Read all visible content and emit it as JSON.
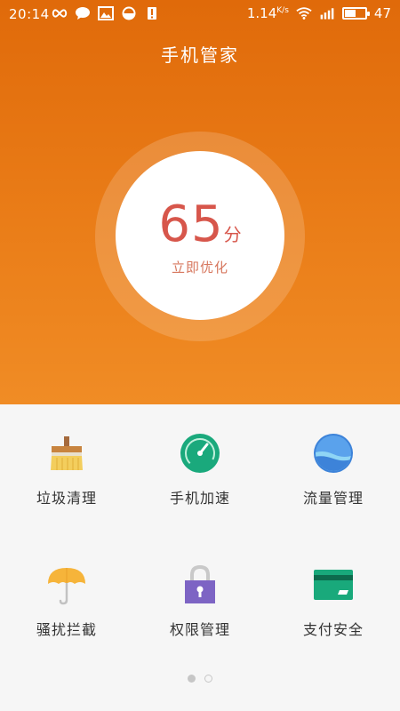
{
  "status": {
    "time": "20:14",
    "net_speed": "1.14",
    "net_unit": "K/s",
    "battery": "47",
    "icons": [
      "infinity-icon",
      "chat-icon",
      "image-icon",
      "theme-icon",
      "alert-icon",
      "wifi-icon",
      "signal-icon",
      "battery-icon"
    ]
  },
  "header": {
    "title": "手机管家"
  },
  "score": {
    "value": "65",
    "unit": "分",
    "action": "立即优化"
  },
  "tools": [
    {
      "label": "垃圾清理",
      "icon": "broom-icon"
    },
    {
      "label": "手机加速",
      "icon": "speedometer-icon"
    },
    {
      "label": "流量管理",
      "icon": "water-ball-icon"
    },
    {
      "label": "骚扰拦截",
      "icon": "umbrella-icon"
    },
    {
      "label": "权限管理",
      "icon": "lock-icon"
    },
    {
      "label": "支付安全",
      "icon": "card-icon"
    }
  ],
  "pager": {
    "pages": 2,
    "current": 1
  },
  "colors": {
    "accent": "#e06a0a",
    "score_red": "#d7564b"
  }
}
